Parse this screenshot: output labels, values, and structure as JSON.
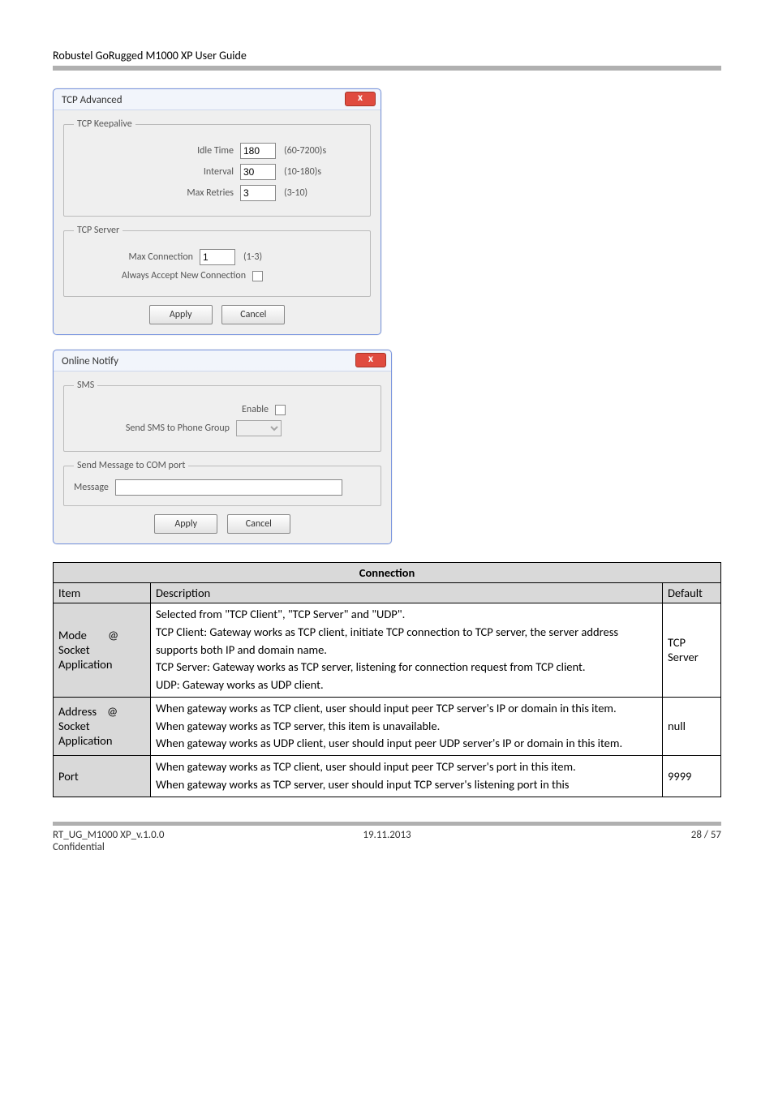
{
  "header": {
    "title": "Robustel GoRugged M1000 XP User Guide"
  },
  "dialog1": {
    "title": "TCP Advanced",
    "close_glyph": "x",
    "keepalive": {
      "legend": "TCP Keepalive",
      "idle_label": "Idle Time",
      "idle_value": "180",
      "idle_hint": "(60-7200)s",
      "interval_label": "Interval",
      "interval_value": "30",
      "interval_hint": "(10-180)s",
      "retries_label": "Max Retries",
      "retries_value": "3",
      "retries_hint": "(3-10)"
    },
    "server": {
      "legend": "TCP Server",
      "maxconn_label": "Max Connection",
      "maxconn_value": "1",
      "maxconn_hint": "(1-3)",
      "always_label": "Always Accept New Connection"
    },
    "apply": "Apply",
    "cancel": "Cancel"
  },
  "dialog2": {
    "title": "Online Notify",
    "close_glyph": "x",
    "sms": {
      "legend": "SMS",
      "enable_label": "Enable",
      "group_label": "Send SMS to Phone Group"
    },
    "com": {
      "legend": "Send Message to COM port",
      "msg_label": "Message"
    },
    "apply": "Apply",
    "cancel": "Cancel"
  },
  "table": {
    "heading": "Connection",
    "col_item": "Item",
    "col_desc": "Description",
    "col_def": "Default",
    "rows": [
      {
        "item": "Mode @ Socket Application",
        "desc": "Selected from \"TCP Client\", \"TCP Server\" and \"UDP\".\nTCP Client: Gateway works as TCP client, initiate TCP connection to TCP server, the server address supports both IP and domain name.\nTCP Server: Gateway works as TCP server, listening for connection request from TCP client.\nUDP: Gateway works as UDP client.",
        "def": "TCP Server"
      },
      {
        "item": "Address @ Socket Application",
        "desc": "When gateway works as TCP client, user should input peer TCP server's IP or domain in this item.\nWhen gateway works as TCP server, this item is unavailable.\nWhen gateway works as UDP client, user should input peer UDP server's IP or domain in this item.",
        "def": "null"
      },
      {
        "item": "Port",
        "desc": "When gateway works as TCP client, user should input peer TCP server's port in this item.\nWhen gateway works as TCP server, user should input TCP server's listening port in this",
        "def": "9999"
      }
    ]
  },
  "footer": {
    "left_line1": "RT_UG_M1000 XP_v.1.0.0",
    "left_line2": "Confidential",
    "center": "19.11.2013",
    "right": "28 / 57"
  }
}
